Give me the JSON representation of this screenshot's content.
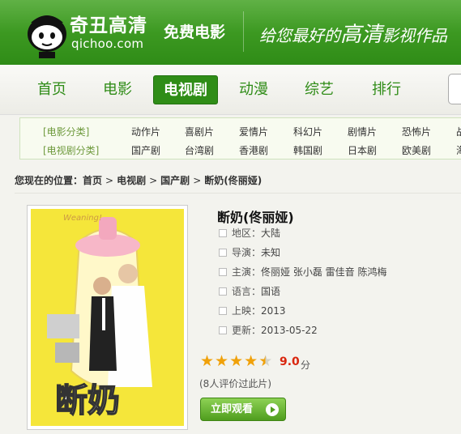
{
  "header": {
    "logo_cn": "奇丑高清",
    "logo_en": "qichoo.com",
    "free_movie": "免费电影",
    "slogan_pre": "给您最好的",
    "slogan_big": "高清",
    "slogan_post": "影视作品"
  },
  "nav": {
    "items": [
      {
        "label": "首页"
      },
      {
        "label": "电影"
      },
      {
        "label": "电视剧",
        "active": true
      },
      {
        "label": "动漫"
      },
      {
        "label": "综艺"
      },
      {
        "label": "排行"
      }
    ]
  },
  "categories": {
    "movie_label": "[电影分类]",
    "tv_label": "[电视剧分类]",
    "movie_links": [
      "动作片",
      "喜剧片",
      "爱情片",
      "科幻片",
      "剧情片",
      "恐怖片",
      "战"
    ],
    "tv_links": [
      "国产剧",
      "台湾剧",
      "香港剧",
      "韩国剧",
      "日本剧",
      "欧美剧",
      "海"
    ]
  },
  "breadcrumb": {
    "prefix": "您现在的位置：",
    "items": [
      "首页",
      "电视剧",
      "国产剧",
      "断奶(佟丽娅)"
    ],
    "sep": ">"
  },
  "movie": {
    "title": "断奶(佟丽娅)",
    "region_label": "地区：",
    "region": "大陆",
    "director_label": "导演：",
    "director": "未知",
    "cast_label": "主演：",
    "cast": "佟丽娅 张小磊 雷佳音 陈鸿梅",
    "language_label": "语言：",
    "language": "国语",
    "release_label": "上映：",
    "release": "2013",
    "updated_label": "更新：",
    "updated": "2013-05-22",
    "score": "9.0",
    "score_unit": "分",
    "rating_fraction": 0.9,
    "votes": "(8人评价过此片)",
    "watch_button": "立即观看",
    "poster_text": "断奶",
    "poster_tag": "Weaning!"
  },
  "colors": {
    "brand_green": "#2f8c17",
    "score_red": "#d9260e",
    "star_gold": "#f0a10a"
  }
}
